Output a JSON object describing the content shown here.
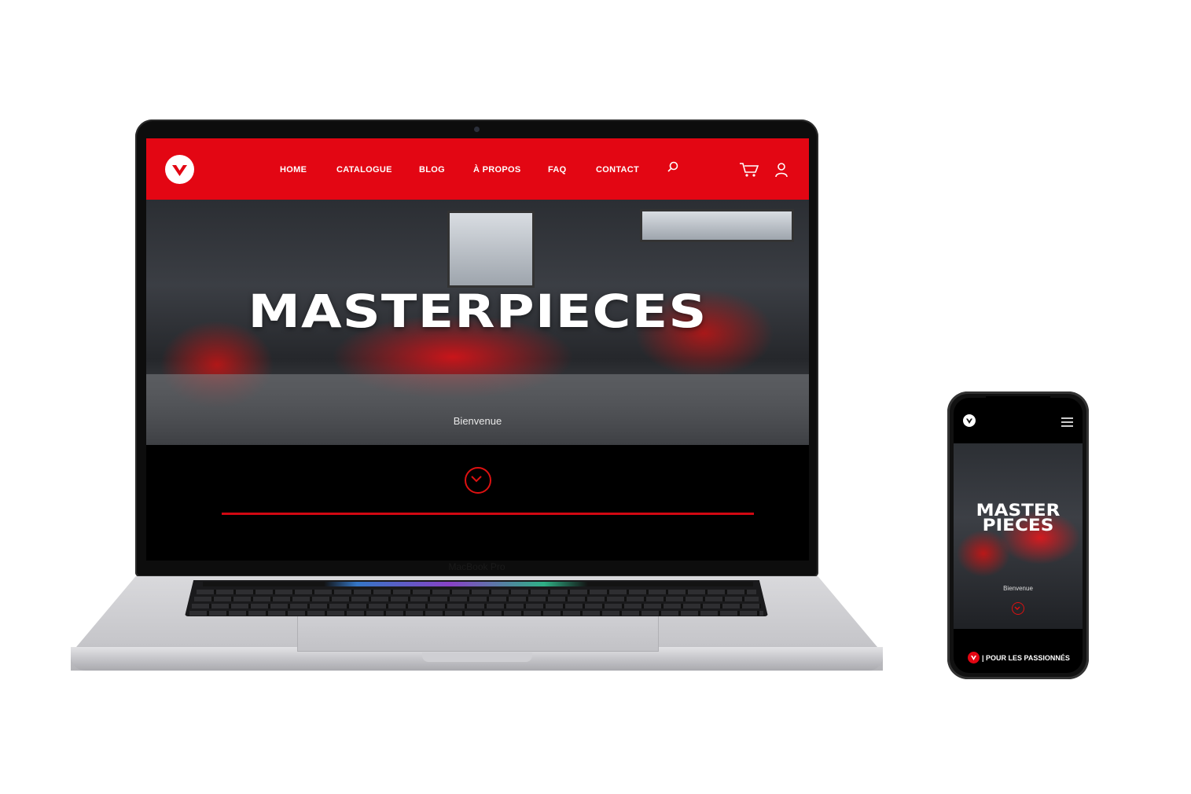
{
  "device_labels": {
    "laptop": "MacBook Pro"
  },
  "site": {
    "nav": {
      "items": [
        "HOME",
        "CATALOGUE",
        "BLOG",
        "À PROPOS",
        "FAQ",
        "CONTACT"
      ]
    },
    "hero": {
      "title": "MASTERPIECES",
      "subtitle": "Bienvenue"
    }
  },
  "mobile": {
    "hero": {
      "title_line1": "MASTER",
      "title_line2": "PIECES",
      "subtitle": "Bienvenue"
    },
    "footer_text": "| POUR LES PASSIONNÉS"
  },
  "colors": {
    "brand_red": "#e30613",
    "background": "#000000",
    "text": "#ffffff"
  },
  "icons": [
    "logo-icon",
    "search-icon",
    "cart-icon",
    "user-icon",
    "chevron-down-icon",
    "hamburger-menu-icon"
  ]
}
